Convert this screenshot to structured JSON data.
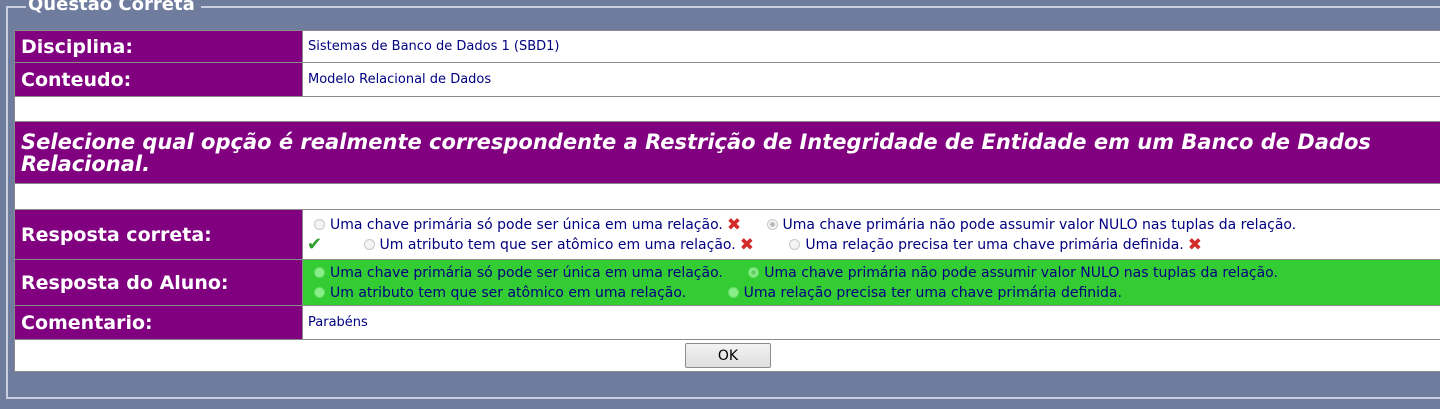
{
  "legend": "Questão Correta",
  "disciplina": {
    "label": "Disciplina:",
    "value": "Sistemas de Banco de Dados 1 (SBD1)"
  },
  "conteudo": {
    "label": "Conteudo:",
    "value": "Modelo Relacional de Dados"
  },
  "question": "Selecione qual opção é realmente correspondente a Restrição de Integridade de Entidade em um Banco de Dados Relacional.",
  "resposta_correta": {
    "label": "Resposta correta:",
    "options": [
      "Uma chave primária só pode ser única em uma relação.",
      "Uma chave primária não pode assumir valor NULO nas tuplas da relação.",
      "Um atributo tem que ser atômico em uma relação.",
      "Uma relação precisa ter uma chave primária definida."
    ],
    "correct_index": 1
  },
  "resposta_aluno": {
    "label": "Resposta do Aluno:",
    "options": [
      "Uma chave primária só pode ser única em uma relação.",
      "Uma chave primária não pode assumir valor NULO nas tuplas da relação.",
      "Um atributo tem que ser atômico em uma relação.",
      "Uma relação precisa ter uma chave primária definida."
    ],
    "selected_index": 1
  },
  "comentario": {
    "label": "Comentario:",
    "value": "Parabéns"
  },
  "ok_label": "OK",
  "colors": {
    "purple": "#800080",
    "green": "#33cc33",
    "background": "#6f7c9e",
    "text_blue": "#000080"
  },
  "icons": {
    "wrong": "red-x-icon",
    "right": "green-check-icon"
  }
}
